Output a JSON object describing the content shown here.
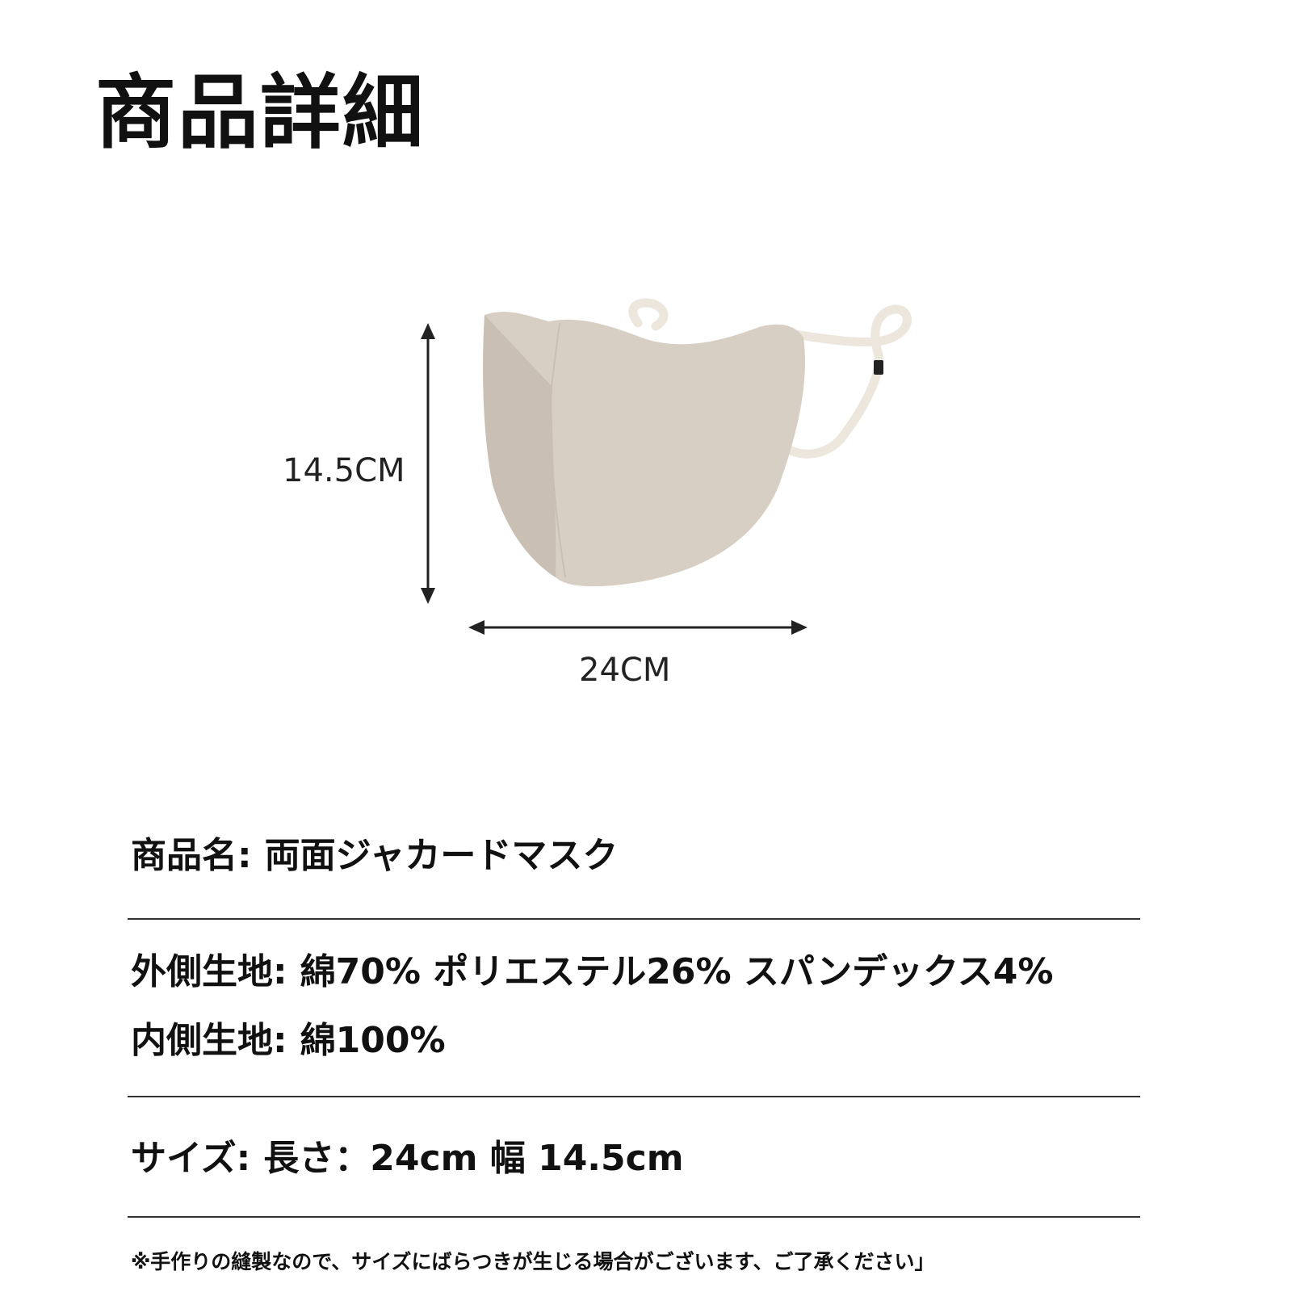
{
  "header": {
    "title": "商品詳細"
  },
  "figure": {
    "height_label": "14.5CM",
    "width_label": "24CM",
    "mask_color": "#d8cfc4",
    "mask_shade": "#c9bfb3",
    "strap_color": "#ece6dd"
  },
  "details": {
    "product_name": {
      "label": "商品名:",
      "value": "両面ジャカードマスク"
    },
    "outer_fabric": {
      "label": "外側生地:",
      "value": "綿70% ポリエステル26% スパンデックス4%"
    },
    "inner_fabric": {
      "label": "内側生地:",
      "value": "綿100%"
    },
    "size": {
      "label": "サイズ:",
      "value": "長さ：24cm 幅 14.5cm"
    }
  },
  "note": "※手作りの縫製なので、サイズにばらつきが生じる場合がございます、ご了承ください」"
}
